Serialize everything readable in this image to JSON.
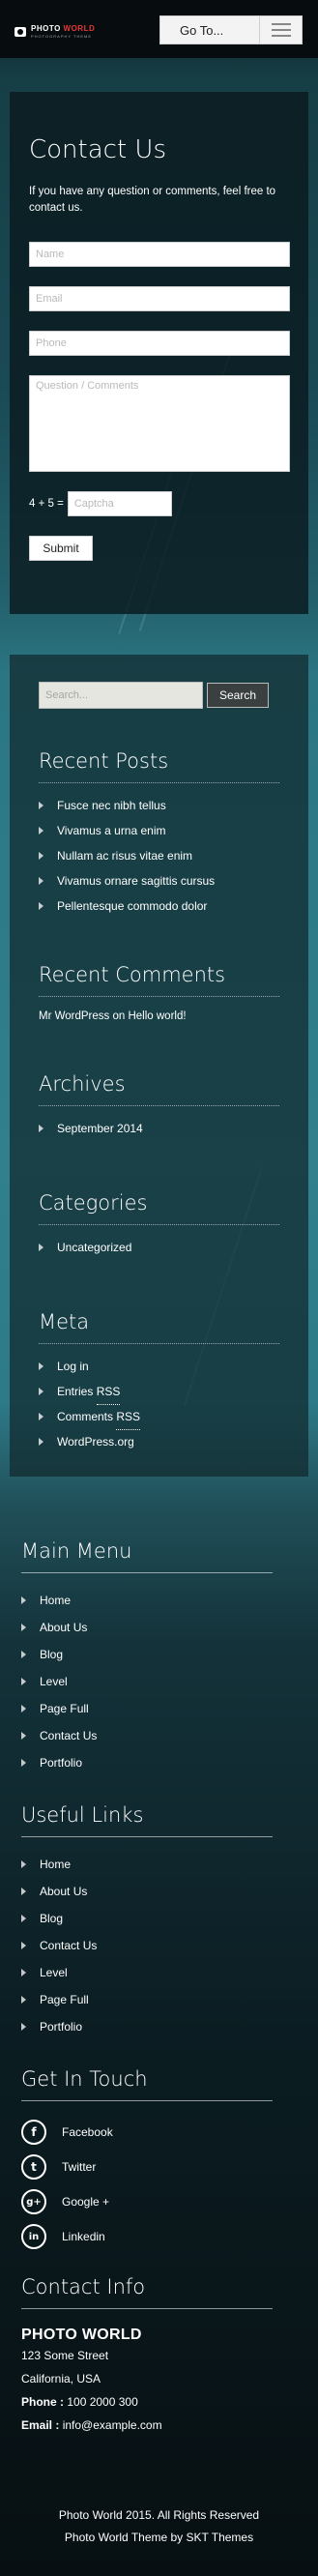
{
  "header": {
    "logo_title_part1": "PHOTO ",
    "logo_title_part2": "WORLD",
    "logo_tagline": "PHOTOGRAPHY THEME",
    "goto_label": "Go To..."
  },
  "contact": {
    "title": "Contact Us",
    "intro": "If you have any question or comments, feel free to contact us.",
    "name_placeholder": "Name",
    "email_placeholder": "Email",
    "phone_placeholder": "Phone",
    "message_placeholder": "Question / Comments",
    "captcha_question": "4 + 5 =",
    "captcha_placeholder": "Captcha",
    "submit_label": "Submit"
  },
  "sidebar": {
    "search_placeholder": "Search...",
    "search_button": "Search",
    "recent_posts_title": "Recent Posts",
    "recent_posts": [
      "Fusce nec nibh tellus",
      "Vivamus a urna enim",
      "Nullam ac risus vitae enim",
      "Vivamus ornare sagittis cursus",
      "Pellentesque commodo dolor"
    ],
    "recent_comments_title": "Recent Comments",
    "recent_comment_author": "Mr WordPress",
    "recent_comment_on": " on ",
    "recent_comment_post": "Hello world!",
    "archives_title": "Archives",
    "archives": [
      "September 2014"
    ],
    "categories_title": "Categories",
    "categories": [
      "Uncategorized"
    ],
    "meta_title": "Meta",
    "meta_login": "Log in",
    "meta_entries": "Entries ",
    "meta_comments": "Comments ",
    "meta_rss": "RSS",
    "meta_wordpress": "WordPress.org"
  },
  "footer": {
    "main_menu_title": "Main Menu",
    "main_menu": [
      "Home",
      "About Us",
      "Blog",
      "Level",
      "Page Full",
      "Contact Us",
      "Portfolio"
    ],
    "useful_links_title": "Useful Links",
    "useful_links": [
      "Home",
      "About Us",
      "Blog",
      "Contact Us",
      "Level",
      "Page Full",
      "Portfolio"
    ],
    "get_in_touch_title": "Get In Touch",
    "social": [
      {
        "icon": "facebook-icon",
        "glyph": "f",
        "label": "Facebook"
      },
      {
        "icon": "twitter-icon",
        "glyph": "t",
        "label": "Twitter"
      },
      {
        "icon": "google-plus-icon",
        "glyph": "g+",
        "label": "Google +"
      },
      {
        "icon": "linkedin-icon",
        "glyph": "in",
        "label": "Linkedin"
      }
    ],
    "contact_info_title": "Contact Info",
    "company": "PHOTO WORLD",
    "address1": "123 Some Street",
    "address2": "California, USA",
    "phone_label": "Phone : ",
    "phone": "100 2000 300",
    "email_label": "Email : ",
    "email": "info@example.com",
    "copyright1": "Photo World 2015. All Rights Reserved",
    "copyright2": "Photo World Theme by SKT Themes"
  },
  "colors": {
    "accent": "#e53935",
    "header_bg": "#070c0e"
  }
}
